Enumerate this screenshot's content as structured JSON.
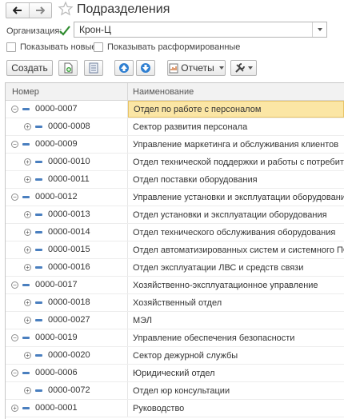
{
  "header": {
    "title": "Подразделения"
  },
  "organization": {
    "label": "Организация:",
    "value": "Крон-Ц"
  },
  "filters": {
    "show_new": "Показывать новые",
    "show_disbanded": "Показывать расформированные"
  },
  "toolbar": {
    "create": "Создать",
    "reports": "Отчеты"
  },
  "table": {
    "columns": {
      "number": "Номер",
      "name": "Наименование"
    },
    "rows": [
      {
        "code": "0000-0007",
        "name": "Отдел по работе с персоналом",
        "level": 0,
        "expanded": true,
        "selected": true
      },
      {
        "code": "0000-0008",
        "name": "Сектор развития персонала",
        "level": 1,
        "expanded": false,
        "selected": false
      },
      {
        "code": "0000-0009",
        "name": "Управление маркетинга и обслуживания клиентов",
        "level": 0,
        "expanded": true,
        "selected": false
      },
      {
        "code": "0000-0010",
        "name": "Отдел технической поддержки и работы с потребителями",
        "level": 1,
        "expanded": false,
        "selected": false
      },
      {
        "code": "0000-0011",
        "name": "Отдел поставки оборудования",
        "level": 1,
        "expanded": false,
        "selected": false
      },
      {
        "code": "0000-0012",
        "name": "Управление установки и эксплуатации оборудования",
        "level": 0,
        "expanded": true,
        "selected": false
      },
      {
        "code": "0000-0013",
        "name": "Отдел установки и эксплуатации оборудования",
        "level": 1,
        "expanded": false,
        "selected": false
      },
      {
        "code": "0000-0014",
        "name": "Отдел технического обслуживания оборудования",
        "level": 1,
        "expanded": false,
        "selected": false
      },
      {
        "code": "0000-0015",
        "name": "Отдел автоматизированных систем и системного ПО",
        "level": 1,
        "expanded": false,
        "selected": false
      },
      {
        "code": "0000-0016",
        "name": "Отдел эксплуатации ЛВС и средств связи",
        "level": 1,
        "expanded": false,
        "selected": false
      },
      {
        "code": "0000-0017",
        "name": "Хозяйственно-эксплуатационное управление",
        "level": 0,
        "expanded": true,
        "selected": false
      },
      {
        "code": "0000-0018",
        "name": "Хозяйственный отдел",
        "level": 1,
        "expanded": false,
        "selected": false
      },
      {
        "code": "0000-0027",
        "name": "МЭЛ",
        "level": 1,
        "expanded": false,
        "selected": false
      },
      {
        "code": "0000-0019",
        "name": "Управление обеспечения безопасности",
        "level": 0,
        "expanded": true,
        "selected": false
      },
      {
        "code": "0000-0020",
        "name": "Сектор дежурной службы",
        "level": 1,
        "expanded": false,
        "selected": false
      },
      {
        "code": "0000-0006",
        "name": "Юридический отдел",
        "level": 0,
        "expanded": true,
        "selected": false
      },
      {
        "code": "0000-0072",
        "name": "Отдел юр консультации",
        "level": 1,
        "expanded": false,
        "selected": false
      },
      {
        "code": "0000-0001",
        "name": "Руководство",
        "level": 0,
        "expanded": false,
        "selected": false
      }
    ]
  }
}
